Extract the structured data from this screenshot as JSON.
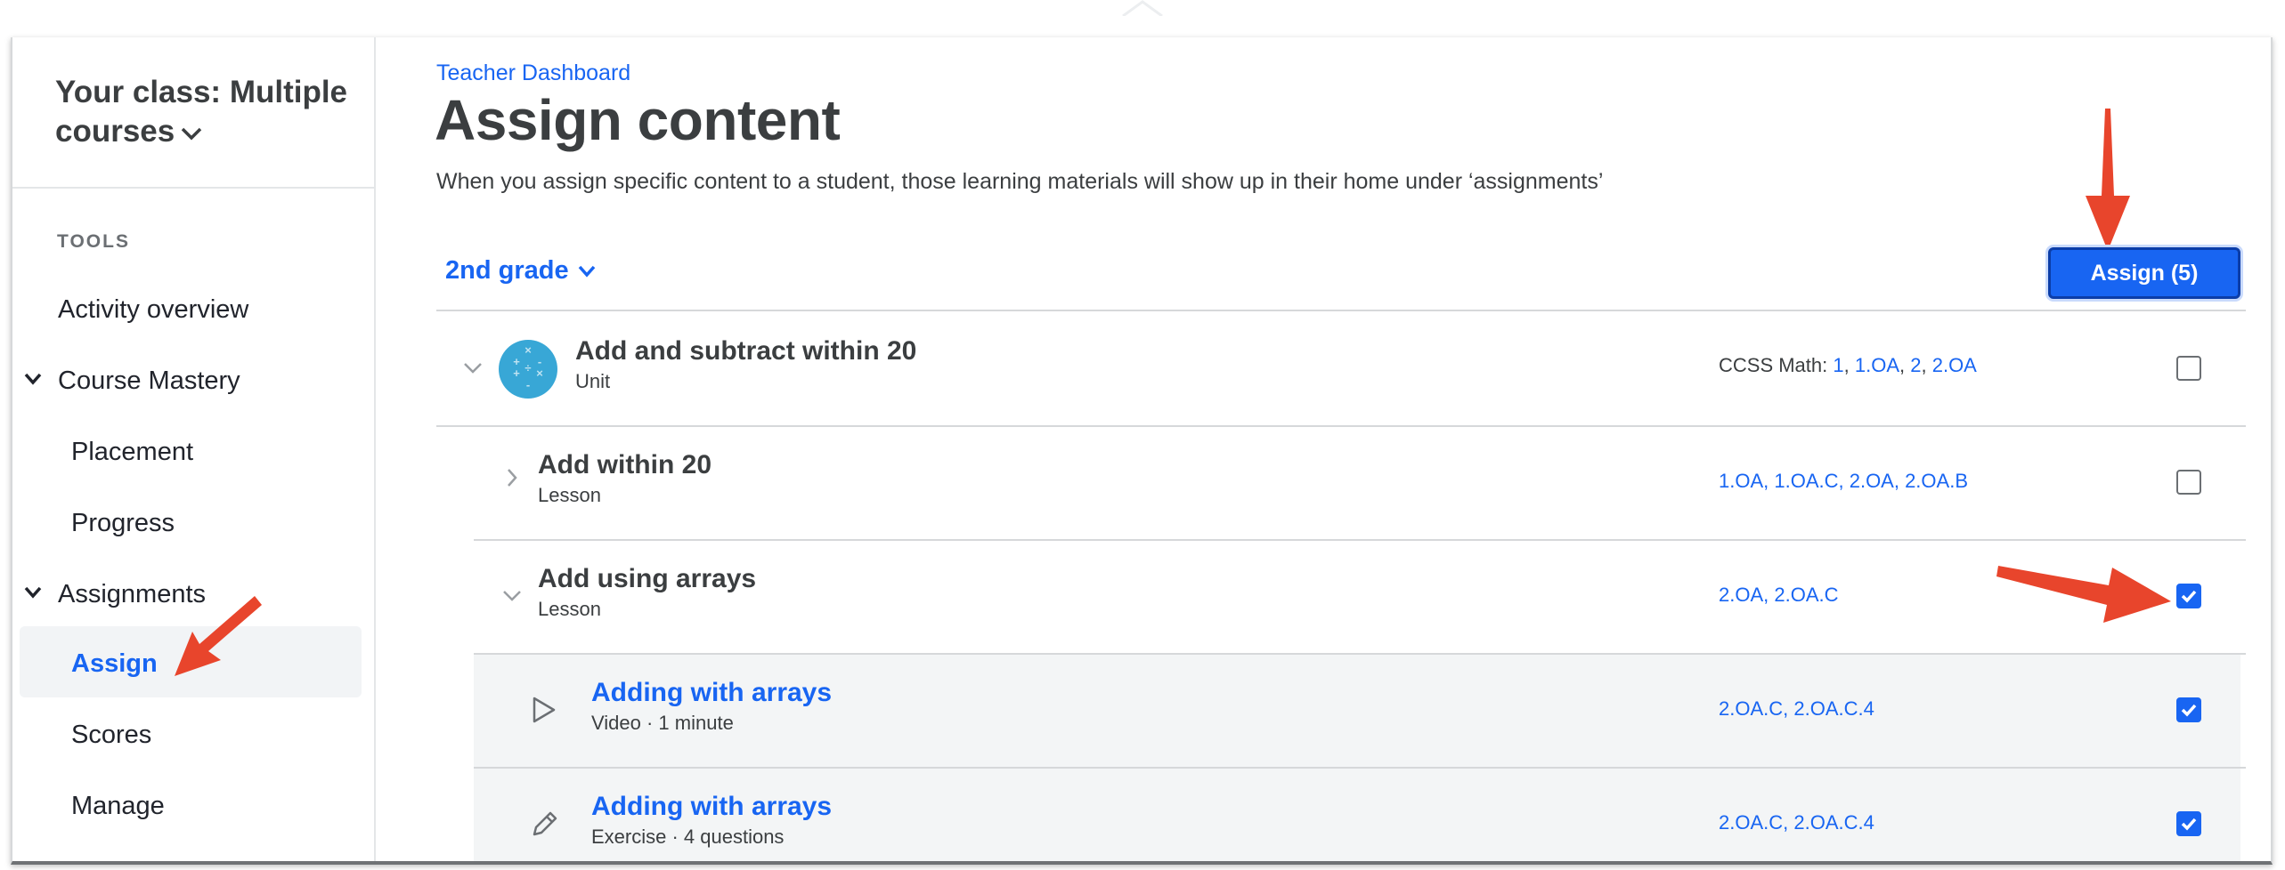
{
  "sidebar": {
    "class_title_line1": "Your class: Multiple",
    "class_title_line2": "courses",
    "tools_label": "TOOLS",
    "items": [
      {
        "label": "Activity overview"
      },
      {
        "label": "Course Mastery"
      },
      {
        "label": "Placement"
      },
      {
        "label": "Progress"
      },
      {
        "label": "Assignments"
      },
      {
        "label": "Assign"
      },
      {
        "label": "Scores"
      },
      {
        "label": "Manage"
      }
    ]
  },
  "header": {
    "breadcrumb": "Teacher Dashboard",
    "title": "Assign content",
    "subtitle": "When you assign specific content to a student, those learning materials will show up in their home under ‘assignments’"
  },
  "toolbar": {
    "grade": "2nd grade",
    "assign_label": "Assign (5)"
  },
  "rows": [
    {
      "title": "Add and subtract within 20",
      "subtitle": "Unit",
      "std_prefix": "CCSS Math: ",
      "standards": [
        "1",
        "1.OA",
        "2",
        "2.OA"
      ],
      "checked": false
    },
    {
      "title": "Add within 20",
      "subtitle": "Lesson",
      "standards_text": "1.OA, 1.OA.C, 2.OA, 2.OA.B",
      "checked": false
    },
    {
      "title": "Add using arrays",
      "subtitle": "Lesson",
      "standards_text": "2.OA, 2.OA.C",
      "checked": true
    },
    {
      "title": "Adding with arrays",
      "subtitle": "Video · 1 minute",
      "standards_text": "2.OA.C, 2.OA.C.4",
      "checked": true
    },
    {
      "title": "Adding with arrays",
      "subtitle": "Exercise · 4 questions",
      "standards_text": "2.OA.C, 2.OA.C.4",
      "checked": true
    }
  ],
  "colors": {
    "accent": "#1865f2",
    "annotation_arrow": "#e8452c",
    "text": "#3b3e40"
  }
}
